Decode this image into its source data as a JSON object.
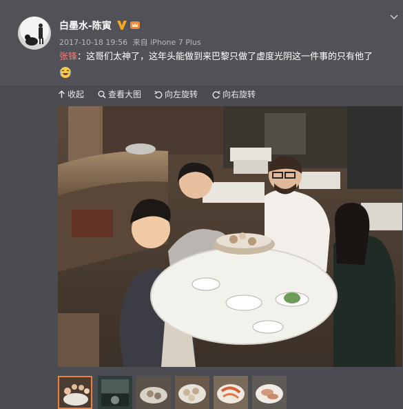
{
  "post": {
    "username": "白墨水-陈寅",
    "date": "2017-10-18 19:56",
    "source_prefix": "来自",
    "source": "iPhone 7 Plus",
    "mention": "张锋",
    "text": "：这哥们太神了，这年头能做到来巴黎只做了虚度光阴这一件事的只有他了"
  },
  "toolbar": {
    "collapse_label": "收起",
    "view_large_label": "查看大图",
    "rotate_left_label": "向左旋转",
    "rotate_right_label": "向右旋转"
  },
  "icons": {
    "verified": "verified-v-icon",
    "vip": "vip-crown-icon",
    "emoji": "laugh-cry-emoji-icon",
    "collapse": "up-arrow-icon",
    "view_large": "magnifier-icon",
    "rotate_left": "rotate-left-icon",
    "rotate_right": "rotate-right-icon"
  },
  "thumbnails": [
    {
      "name": "thumb-1",
      "selected": true
    },
    {
      "name": "thumb-2",
      "selected": false
    },
    {
      "name": "thumb-3",
      "selected": false
    },
    {
      "name": "thumb-4",
      "selected": false
    },
    {
      "name": "thumb-5",
      "selected": false
    },
    {
      "name": "thumb-6",
      "selected": false
    }
  ],
  "colors": {
    "background": "#4a4c52",
    "mention": "#ff7a72",
    "verified_badge": "#f5a623",
    "thumb_selected_border": "#f07f3c"
  }
}
